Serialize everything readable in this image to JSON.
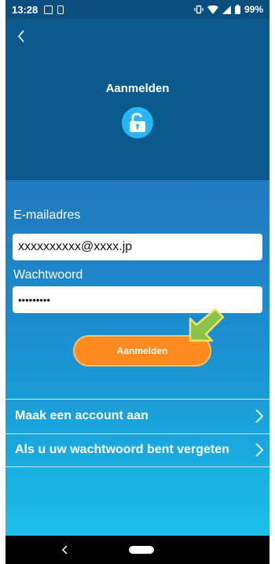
{
  "status_bar": {
    "time": "13:28",
    "battery": "99%"
  },
  "header": {
    "title": "Aanmelden",
    "icon": "unlock-icon"
  },
  "form": {
    "email_label": "E-mailadres",
    "email_value": "xxxxxxxxxx@xxxx.jp",
    "password_label": "Wachtwoord",
    "password_value": "•••••••••",
    "submit_label": "Aanmelden"
  },
  "menu": {
    "items": [
      {
        "label": "Maak een account aan"
      },
      {
        "label": "Als u uw wachtwoord bent vergeten"
      }
    ]
  },
  "colors": {
    "header_bg": "#0B5A8E",
    "accent_orange": "#FF8A1E",
    "lock_circle": "#29B6F6",
    "pointer_green": "#8BC34A"
  }
}
